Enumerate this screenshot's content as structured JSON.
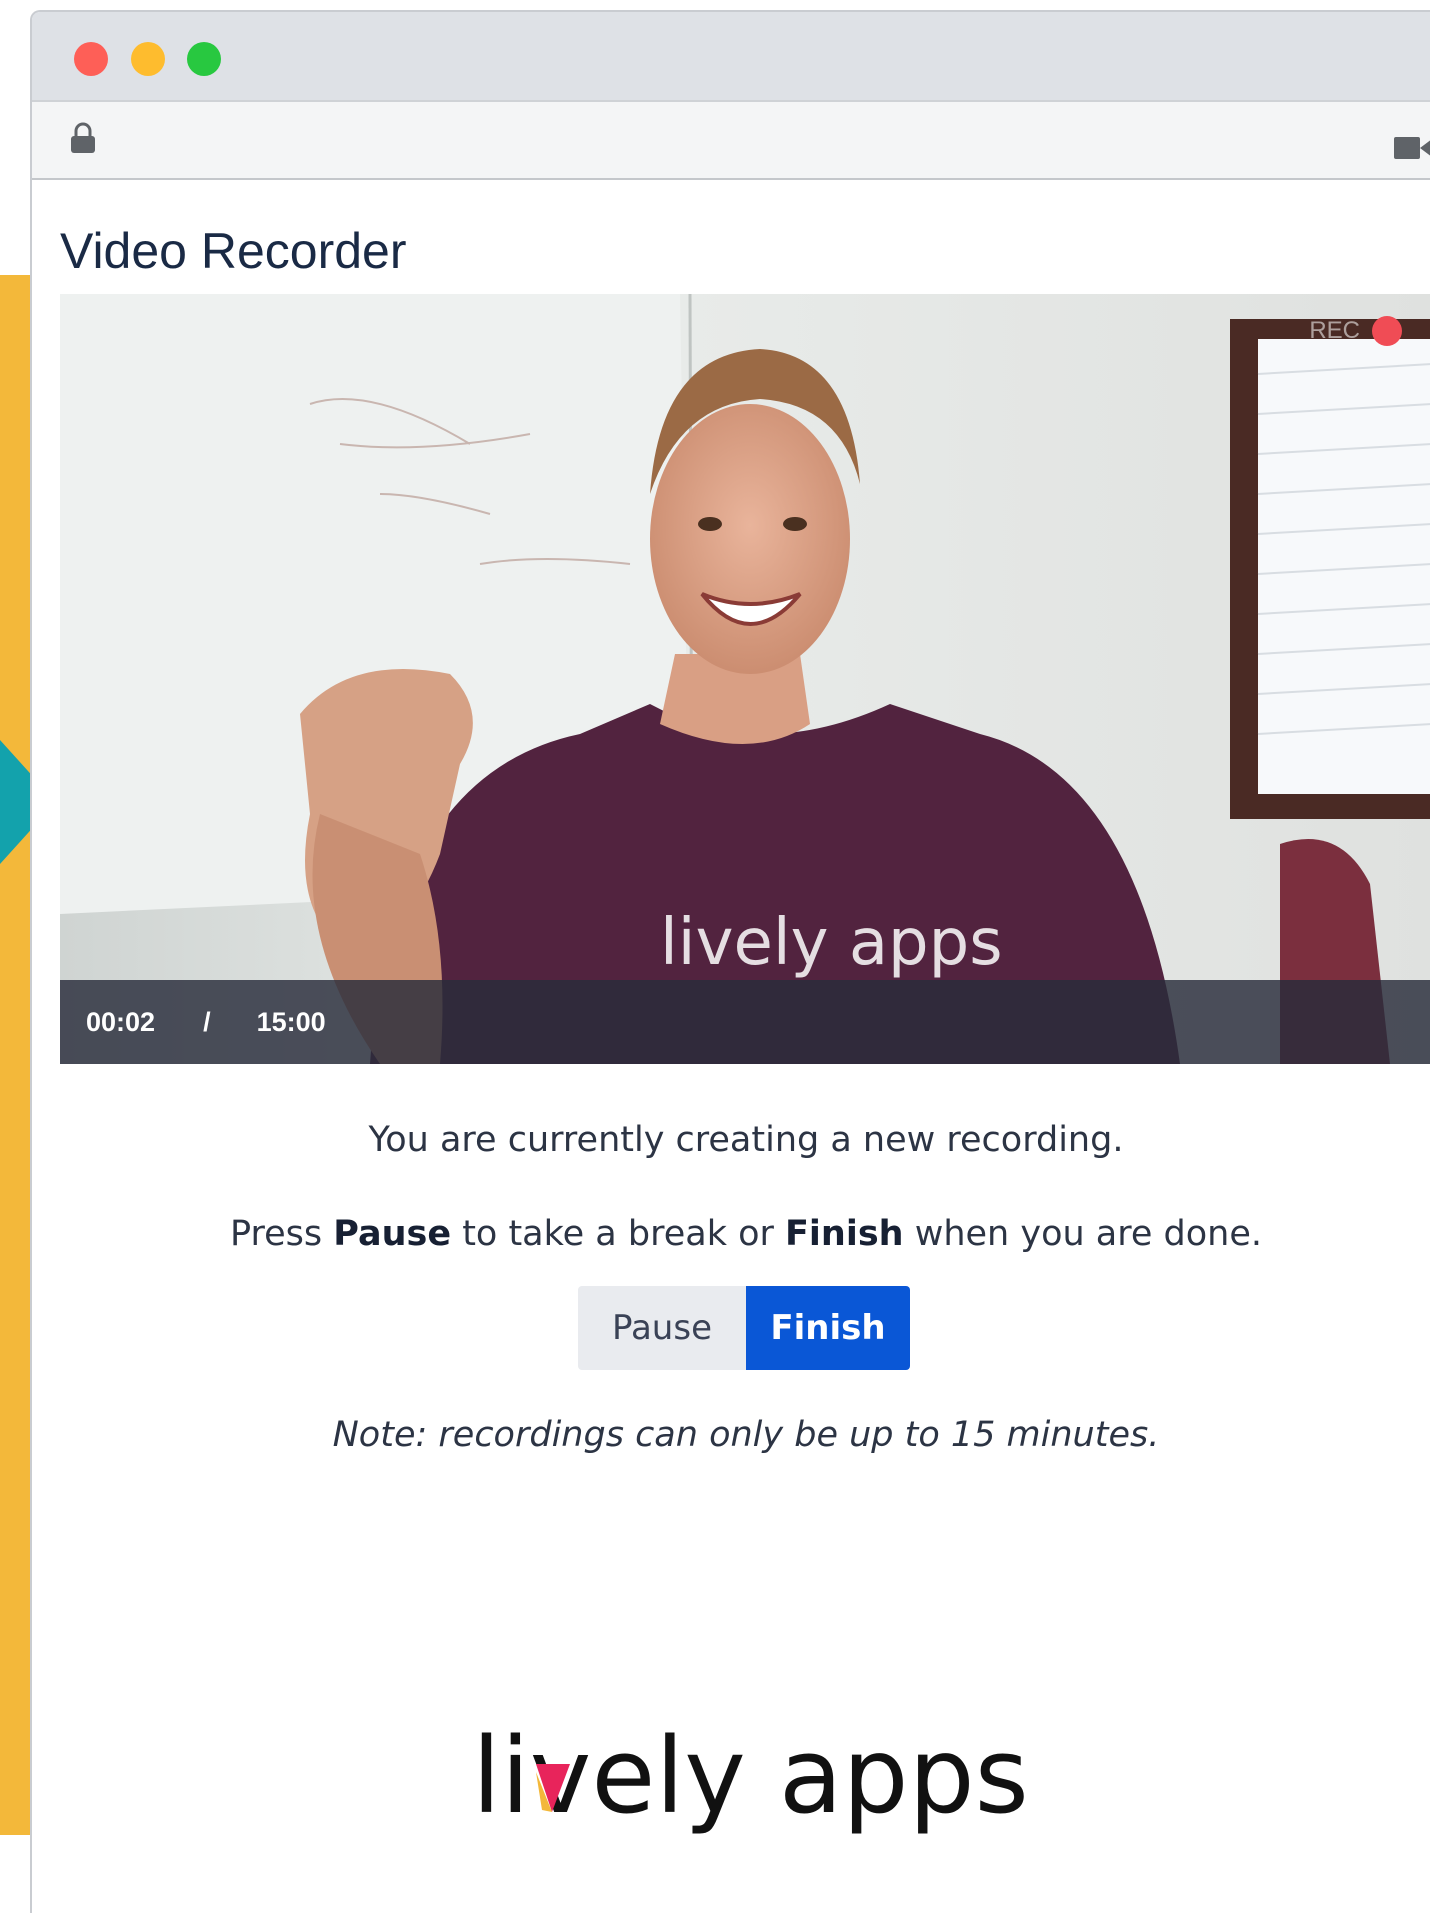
{
  "page": {
    "title": "Video Recorder"
  },
  "video": {
    "current_time": "00:02",
    "separator": "/",
    "total_time": "15:00",
    "rec_label": "REC",
    "shirt_logo": "lively apps"
  },
  "message": {
    "status": "You are currently creating a new recording.",
    "instruction_prefix": "Press ",
    "instruction_pause": "Pause",
    "instruction_middle": " to take a break or ",
    "instruction_finish": "Finish",
    "instruction_suffix": " when you are done.",
    "note": "Note: recordings can only be up to 15 minutes."
  },
  "buttons": {
    "pause_label": "Pause",
    "finish_label": "Finish"
  },
  "footer": {
    "logo_text": "lively apps"
  },
  "colors": {
    "finish_button": "#0a57d6",
    "rec_dot": "#f04c55",
    "accent_yellow": "#f3b83a",
    "accent_teal": "#13a2ac"
  }
}
